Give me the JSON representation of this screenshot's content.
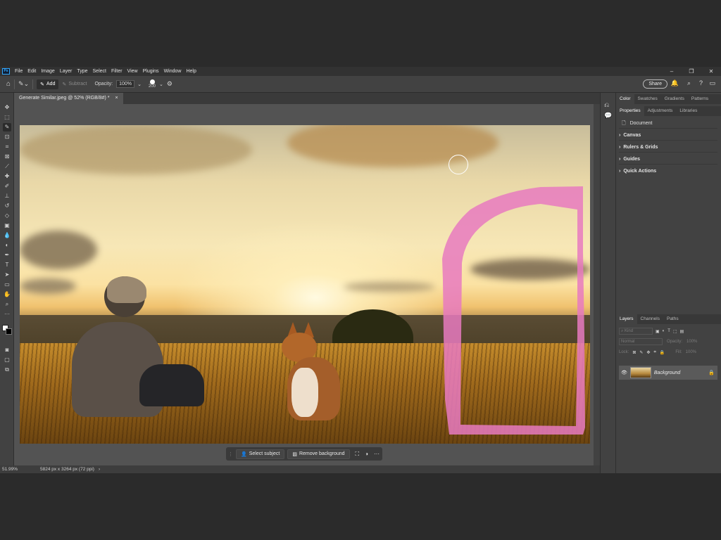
{
  "app": {
    "logo": "Ps"
  },
  "menu": [
    "File",
    "Edit",
    "Image",
    "Layer",
    "Type",
    "Select",
    "Filter",
    "View",
    "Plugins",
    "Window",
    "Help"
  ],
  "options_bar": {
    "add_label": "Add",
    "subtract_label": "Subtract",
    "opacity_label": "Opacity:",
    "opacity_value": "100%",
    "brush_size": "200",
    "share_label": "Share"
  },
  "document_tab": {
    "title": "Generate Similar.jpeg @ 52% (RGB/8#) *",
    "close": "×"
  },
  "context_bar": {
    "select_subject": "Select subject",
    "remove_background": "Remove background",
    "more": "···"
  },
  "status_bar": {
    "zoom": "51.99%",
    "doc_size": "5824 px x 3264 px (72 ppi)",
    "arrow": "›"
  },
  "panels": {
    "top_tabs": [
      "Color",
      "Swatches",
      "Gradients",
      "Patterns"
    ],
    "prop_tabs": [
      "Properties",
      "Adjustments",
      "Libraries"
    ],
    "document_label": "Document",
    "sections": [
      "Canvas",
      "Rulers & Grids",
      "Guides",
      "Quick Actions"
    ],
    "layer_tabs": [
      "Layers",
      "Channels",
      "Paths"
    ],
    "kind_label": "Kind",
    "blend_mode": "Normal",
    "opacity_label": "Opacity:",
    "opacity_value": "100%",
    "lock_label": "Lock:",
    "fill_label": "Fill:",
    "fill_value": "100%",
    "layer_name": "Background"
  },
  "colors": {
    "accent": "#31a8ff",
    "mask_pink": "#e87ac0",
    "ui_bg": "#535353",
    "panel_bg": "#424242"
  }
}
